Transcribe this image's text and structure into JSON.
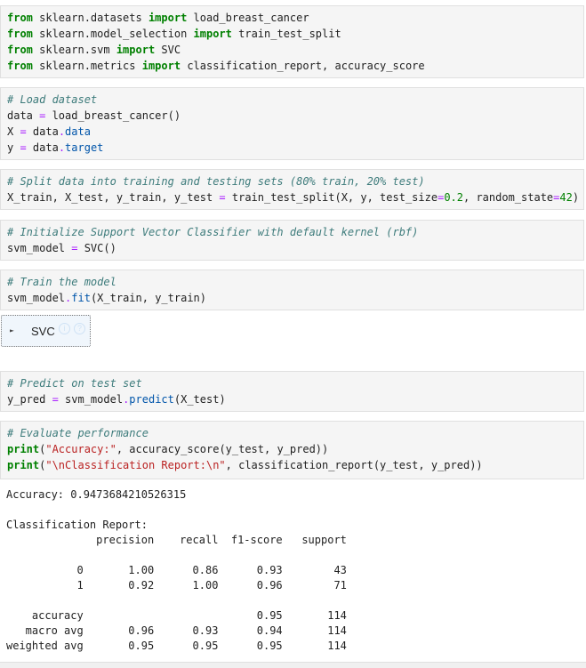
{
  "cells": [
    {
      "lines": [
        [
          {
            "t": "from",
            "c": "kw"
          },
          {
            "t": " sklearn.datasets "
          },
          {
            "t": "import",
            "c": "kw"
          },
          {
            "t": " load_breast_cancer"
          }
        ],
        [
          {
            "t": "from",
            "c": "kw"
          },
          {
            "t": " sklearn.model_selection "
          },
          {
            "t": "import",
            "c": "kw"
          },
          {
            "t": " train_test_split"
          }
        ],
        [
          {
            "t": "from",
            "c": "kw"
          },
          {
            "t": " sklearn.svm "
          },
          {
            "t": "import",
            "c": "kw"
          },
          {
            "t": " SVC"
          }
        ],
        [
          {
            "t": "from",
            "c": "kw"
          },
          {
            "t": " sklearn.metrics "
          },
          {
            "t": "import",
            "c": "kw"
          },
          {
            "t": " classification_report, accuracy_score"
          }
        ]
      ]
    },
    {
      "lines": [
        [
          {
            "t": "# Load dataset",
            "c": "cm"
          }
        ],
        [
          {
            "t": "data "
          },
          {
            "t": "=",
            "c": "op"
          },
          {
            "t": " load_breast_cancer()"
          }
        ],
        [
          {
            "t": "X "
          },
          {
            "t": "=",
            "c": "op"
          },
          {
            "t": " data"
          },
          {
            "t": ".",
            "c": "op"
          },
          {
            "t": "data",
            "c": "attr"
          }
        ],
        [
          {
            "t": "y "
          },
          {
            "t": "=",
            "c": "op"
          },
          {
            "t": " data"
          },
          {
            "t": ".",
            "c": "op"
          },
          {
            "t": "target",
            "c": "attr"
          }
        ]
      ]
    },
    {
      "lines": [
        [
          {
            "t": "# Split data into training and testing sets (80% train, 20% test)",
            "c": "cm"
          }
        ],
        [
          {
            "t": "X_train, X_test, y_train, y_test "
          },
          {
            "t": "=",
            "c": "op"
          },
          {
            "t": " train_test_split(X, y, test_size"
          },
          {
            "t": "=",
            "c": "op"
          },
          {
            "t": "0.2",
            "c": "num"
          },
          {
            "t": ", random_state"
          },
          {
            "t": "=",
            "c": "op"
          },
          {
            "t": "42",
            "c": "num"
          },
          {
            "t": ")"
          }
        ]
      ]
    },
    {
      "lines": [
        [
          {
            "t": "# Initialize Support Vector Classifier with default kernel (rbf)",
            "c": "cm"
          }
        ],
        [
          {
            "t": "svm_model "
          },
          {
            "t": "=",
            "c": "op"
          },
          {
            "t": " SVC()"
          }
        ]
      ]
    },
    {
      "lines": [
        [
          {
            "t": "# Train the model",
            "c": "cm"
          }
        ],
        [
          {
            "t": "svm_model"
          },
          {
            "t": ".",
            "c": "op"
          },
          {
            "t": "fit",
            "c": "attr"
          },
          {
            "t": "(X_train, y_train)"
          }
        ]
      ]
    },
    {
      "lines": [
        [
          {
            "t": "# Predict on test set",
            "c": "cm"
          }
        ],
        [
          {
            "t": "y_pred "
          },
          {
            "t": "=",
            "c": "op"
          },
          {
            "t": " svm_model"
          },
          {
            "t": ".",
            "c": "op"
          },
          {
            "t": "predict",
            "c": "attr"
          },
          {
            "t": "(X_test)"
          }
        ]
      ]
    },
    {
      "lines": [
        [
          {
            "t": "# Evaluate performance",
            "c": "cm"
          }
        ],
        [
          {
            "t": "print",
            "c": "kw"
          },
          {
            "t": "("
          },
          {
            "t": "\"Accuracy:\"",
            "c": "str"
          },
          {
            "t": ", accuracy_score(y_test, y_pred))"
          }
        ],
        [
          {
            "t": "print",
            "c": "kw"
          },
          {
            "t": "("
          },
          {
            "t": "\"\\nClassification Report:\\n\"",
            "c": "str"
          },
          {
            "t": ", classification_report(y_test, y_pred))"
          }
        ]
      ]
    }
  ],
  "widget": {
    "label": "SVC",
    "badge_info": "i",
    "badge_help": "?"
  },
  "output": {
    "lines": [
      "Accuracy: 0.9473684210526315",
      "",
      "Classification Report:",
      "              precision    recall  f1-score   support",
      "",
      "           0       1.00      0.86      0.93        43",
      "           1       0.92      1.00      0.96        71",
      "",
      "    accuracy                           0.95       114",
      "   macro avg       0.96      0.93      0.94       114",
      "weighted avg       0.95      0.95      0.95       114"
    ]
  }
}
